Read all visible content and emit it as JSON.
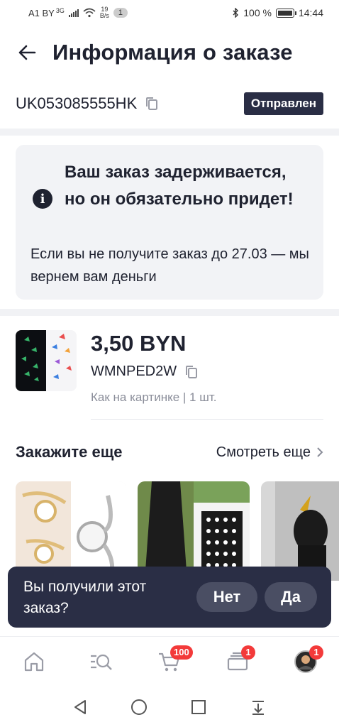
{
  "status_bar": {
    "carrier": "A1 BY",
    "network": "3G",
    "speed_value": "19",
    "speed_unit": "B/s",
    "notification_count": "1",
    "battery": "100 %",
    "time": "14:44"
  },
  "header": {
    "title": "Информация о заказе"
  },
  "order": {
    "number": "UK053085555HK",
    "status": "Отправлен"
  },
  "notice": {
    "title": "Ваш заказ задерживается, но он обязательно придет!",
    "text": "Если вы не получите заказ до 27.03 — мы вернем вам деньги"
  },
  "product": {
    "price": "3,50 BYN",
    "sku": "WMNPED2W",
    "meta": "Как на картинке | 1 шт."
  },
  "reorder": {
    "title": "Закажите еще",
    "see_more": "Смотреть еще"
  },
  "toast": {
    "question": "Вы получили этот заказ?",
    "no_label": "Нет",
    "yes_label": "Да"
  },
  "tab_bar": {
    "cart_badge": "100",
    "orders_badge": "1",
    "profile_badge": "1"
  },
  "colors": {
    "primary_dark": "#2a2e45",
    "badge_red": "#f33a3a",
    "muted_text": "#8a8d99"
  }
}
